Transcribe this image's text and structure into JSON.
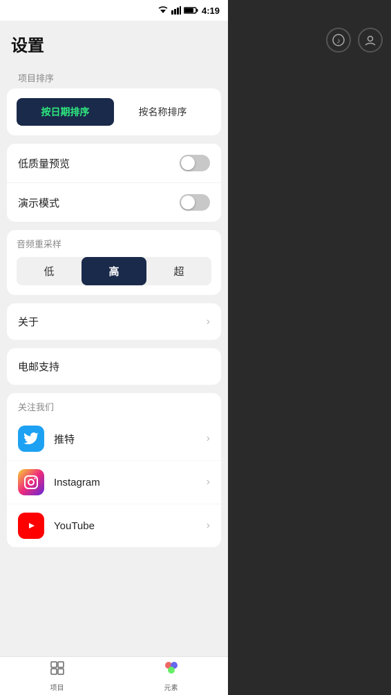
{
  "statusBar": {
    "time": "4:19"
  },
  "page": {
    "title": "设置"
  },
  "sortSection": {
    "label": "项目排序",
    "byDateLabel": "按日期排序",
    "byNameLabel": "按名称排序",
    "activeIndex": 0
  },
  "toggleSection": {
    "lowQualityLabel": "低质量预览",
    "lowQualityOn": false,
    "demoModeLabel": "演示模式",
    "demoModeOn": false
  },
  "audioSection": {
    "label": "音频重采样",
    "options": [
      "低",
      "高",
      "超"
    ],
    "activeIndex": 1
  },
  "aboutSection": {
    "label": "关于"
  },
  "emailSection": {
    "label": "电邮支持"
  },
  "followSection": {
    "label": "关注我们",
    "items": [
      {
        "name": "推特",
        "iconType": "twitter"
      },
      {
        "name": "Instagram",
        "iconType": "instagram"
      },
      {
        "name": "YouTube",
        "iconType": "youtube"
      }
    ]
  },
  "bottomNav": {
    "items": [
      {
        "label": "项目",
        "icon": "📁"
      },
      {
        "label": "元素",
        "icon": "🎨"
      }
    ]
  }
}
